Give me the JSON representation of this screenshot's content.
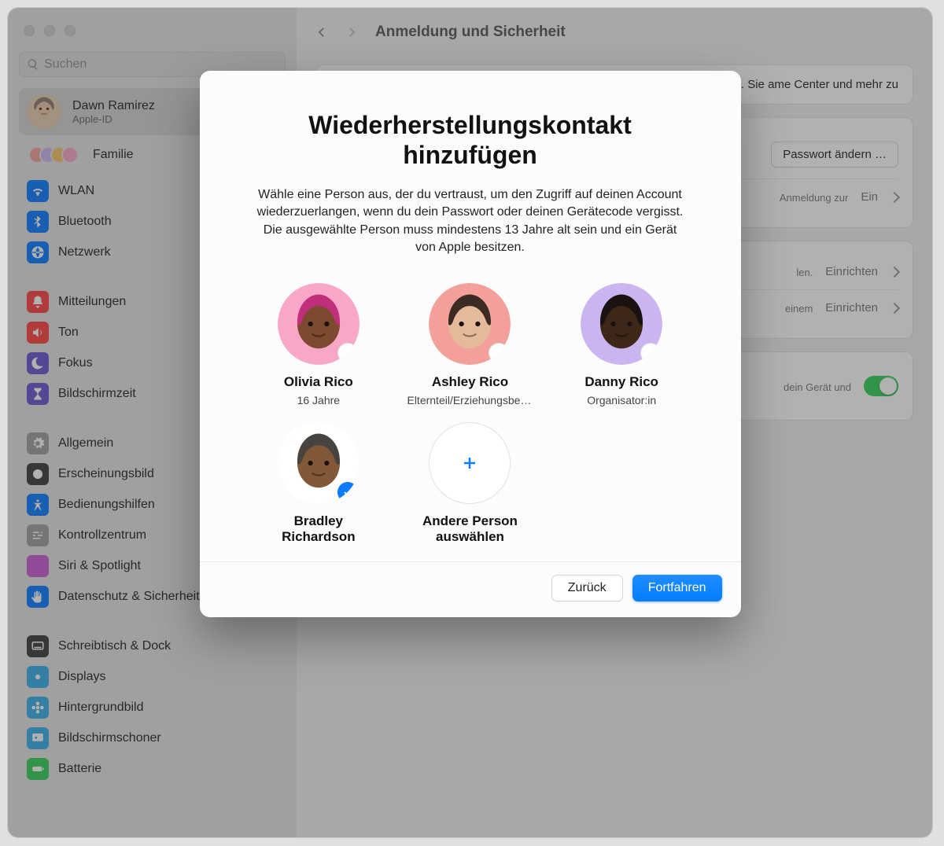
{
  "header": {
    "title": "Anmeldung und Sicherheit"
  },
  "search": {
    "placeholder": "Suchen"
  },
  "user": {
    "name": "Dawn Ramirez",
    "sub": "Apple-ID"
  },
  "family": {
    "label": "Familie"
  },
  "sidebar": {
    "groups": [
      [
        {
          "label": "WLAN",
          "color": "#0a7bff",
          "icon": "wifi"
        },
        {
          "label": "Bluetooth",
          "color": "#0a7bff",
          "icon": "bluetooth"
        },
        {
          "label": "Netzwerk",
          "color": "#0a7bff",
          "icon": "globe"
        }
      ],
      [
        {
          "label": "Mitteilungen",
          "color": "#ff4040",
          "icon": "bell"
        },
        {
          "label": "Ton",
          "color": "#ff4040",
          "icon": "speaker"
        },
        {
          "label": "Fokus",
          "color": "#6a56d0",
          "icon": "moon"
        },
        {
          "label": "Bildschirmzeit",
          "color": "#6a56d0",
          "icon": "hourglass"
        }
      ],
      [
        {
          "label": "Allgemein",
          "color": "#9e9e9e",
          "icon": "gear"
        },
        {
          "label": "Erscheinungsbild",
          "color": "#3a3a3a",
          "icon": "appearance"
        },
        {
          "label": "Bedienungshilfen",
          "color": "#0a7bff",
          "icon": "accessibility"
        },
        {
          "label": "Kontrollzentrum",
          "color": "#9e9e9e",
          "icon": "sliders"
        },
        {
          "label": "Siri & Spotlight",
          "color": "#c85bd1",
          "icon": "siri"
        },
        {
          "label": "Datenschutz & Sicherheit",
          "color": "#0a7bff",
          "icon": "hand"
        }
      ],
      [
        {
          "label": "Schreibtisch & Dock",
          "color": "#3a3a3a",
          "icon": "dock"
        },
        {
          "label": "Displays",
          "color": "#34b0ea",
          "icon": "sun"
        },
        {
          "label": "Hintergrundbild",
          "color": "#34b0ea",
          "icon": "flower"
        },
        {
          "label": "Bildschirmschoner",
          "color": "#34b0ea",
          "icon": "screensaver"
        },
        {
          "label": "Batterie",
          "color": "#32d158",
          "icon": "battery"
        }
      ]
    ]
  },
  "content": {
    "topText": "wendet werden. Sie ame Center und mehr zu",
    "rows": {
      "pw_button": "Passwort ändern …",
      "r1_value": "Ein",
      "r1_sub": "Anmeldung zur",
      "r2_value": "Einrichten",
      "r2_sub": "len.",
      "r3_value": "Einrichten",
      "r3_sub": "einem",
      "r4_sub": "dein Gerät und"
    }
  },
  "modal": {
    "title": "Wiederherstellungskontakt hinzufügen",
    "description": "Wähle eine Person aus, der du vertraust, um den Zugriff auf deinen Account wiederzuerlangen, wenn du dein Passwort oder deinen Gerätecode vergisst. Die ausgewählte Person muss mindestens 13 Jahre alt sein und ein Gerät von Apple besitzen.",
    "contacts": [
      {
        "name": "Olivia Rico",
        "role": "16 Jahre",
        "bg": "#f8a7c8",
        "skin": "#7d4a30",
        "hair": "#c02f7a",
        "selected": false
      },
      {
        "name": "Ashley Rico",
        "role": "Elternteil/Erziehungsberechtigte",
        "bg": "#f2a099",
        "skin": "#e5ba9a",
        "hair": "#3b2b22",
        "selected": false
      },
      {
        "name": "Danny Rico",
        "role": "Organisator:in",
        "bg": "#cab5f0",
        "skin": "#3d2718",
        "hair": "#1a1210",
        "selected": false
      },
      {
        "name": "Bradley Richardson",
        "role": "",
        "bg": "#ffffff",
        "skin": "#825837",
        "hair": "#48433e",
        "selected": true
      }
    ],
    "add_label": "Andere Person auswählen",
    "back": "Zurück",
    "continue": "Fortfahren"
  },
  "colors": {
    "accent": "#0a7bff"
  }
}
